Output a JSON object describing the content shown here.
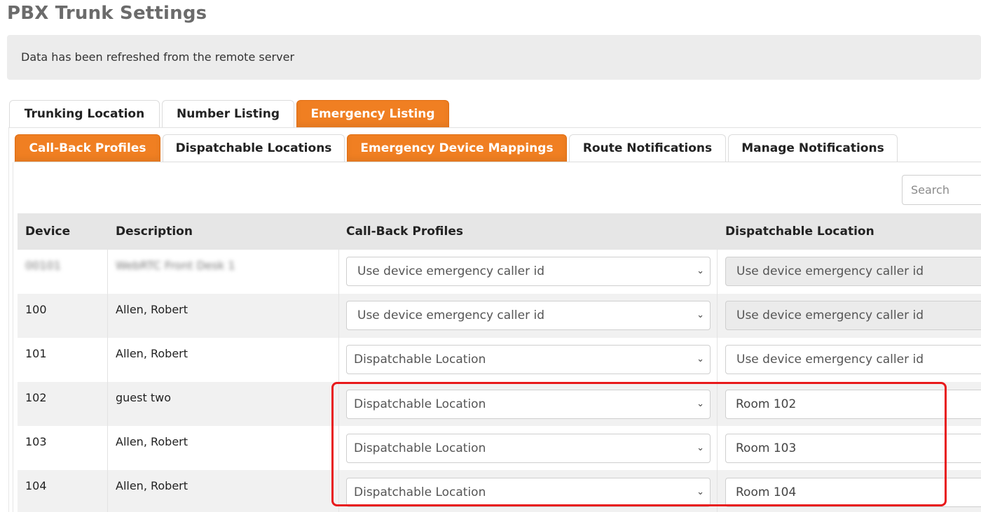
{
  "page": {
    "title": "PBX Trunk Settings"
  },
  "notice": {
    "message": "Data has been refreshed from the remote server"
  },
  "top_tabs": [
    {
      "label": "Trunking Location",
      "active": false
    },
    {
      "label": "Number Listing",
      "active": false
    },
    {
      "label": "Emergency Listing",
      "active": true
    }
  ],
  "sub_tabs": [
    {
      "label": "Call-Back Profiles",
      "active": true
    },
    {
      "label": "Dispatchable Locations",
      "active": false
    },
    {
      "label": "Emergency Device Mappings",
      "active": true
    },
    {
      "label": "Route Notifications",
      "active": false
    },
    {
      "label": "Manage Notifications",
      "active": false
    }
  ],
  "search": {
    "placeholder": "Search"
  },
  "table": {
    "columns": [
      "Device",
      "Description",
      "Call-Back Profiles",
      "Dispatchable Location"
    ],
    "rows": [
      {
        "device": "00101",
        "description": "WebRTC Front Desk 1",
        "callback": "Use device emergency caller id",
        "location": "Use device emergency caller id",
        "location_type": "select-disabled",
        "blurred": true
      },
      {
        "device": "100",
        "description": "Allen, Robert",
        "callback": "Use device emergency caller id",
        "location": "Use device emergency caller id",
        "location_type": "select-disabled",
        "blurred": false
      },
      {
        "device": "101",
        "description": "Allen, Robert",
        "callback": "Dispatchable Location",
        "location": "Use device emergency caller id",
        "location_type": "select",
        "blurred": false
      },
      {
        "device": "102",
        "description": "guest two",
        "callback": "Dispatchable Location",
        "location": "Room 102",
        "location_type": "input",
        "blurred": false
      },
      {
        "device": "103",
        "description": "Allen, Robert",
        "callback": "Dispatchable Location",
        "location": "Room 103",
        "location_type": "input",
        "blurred": false
      },
      {
        "device": "104",
        "description": "Allen, Robert",
        "callback": "Dispatchable Location",
        "location": "Room 104",
        "location_type": "input",
        "blurred": false
      }
    ]
  },
  "colors": {
    "accent": "#f07f22",
    "highlight": "#e8191b",
    "header_bg": "#e6e6e6"
  }
}
